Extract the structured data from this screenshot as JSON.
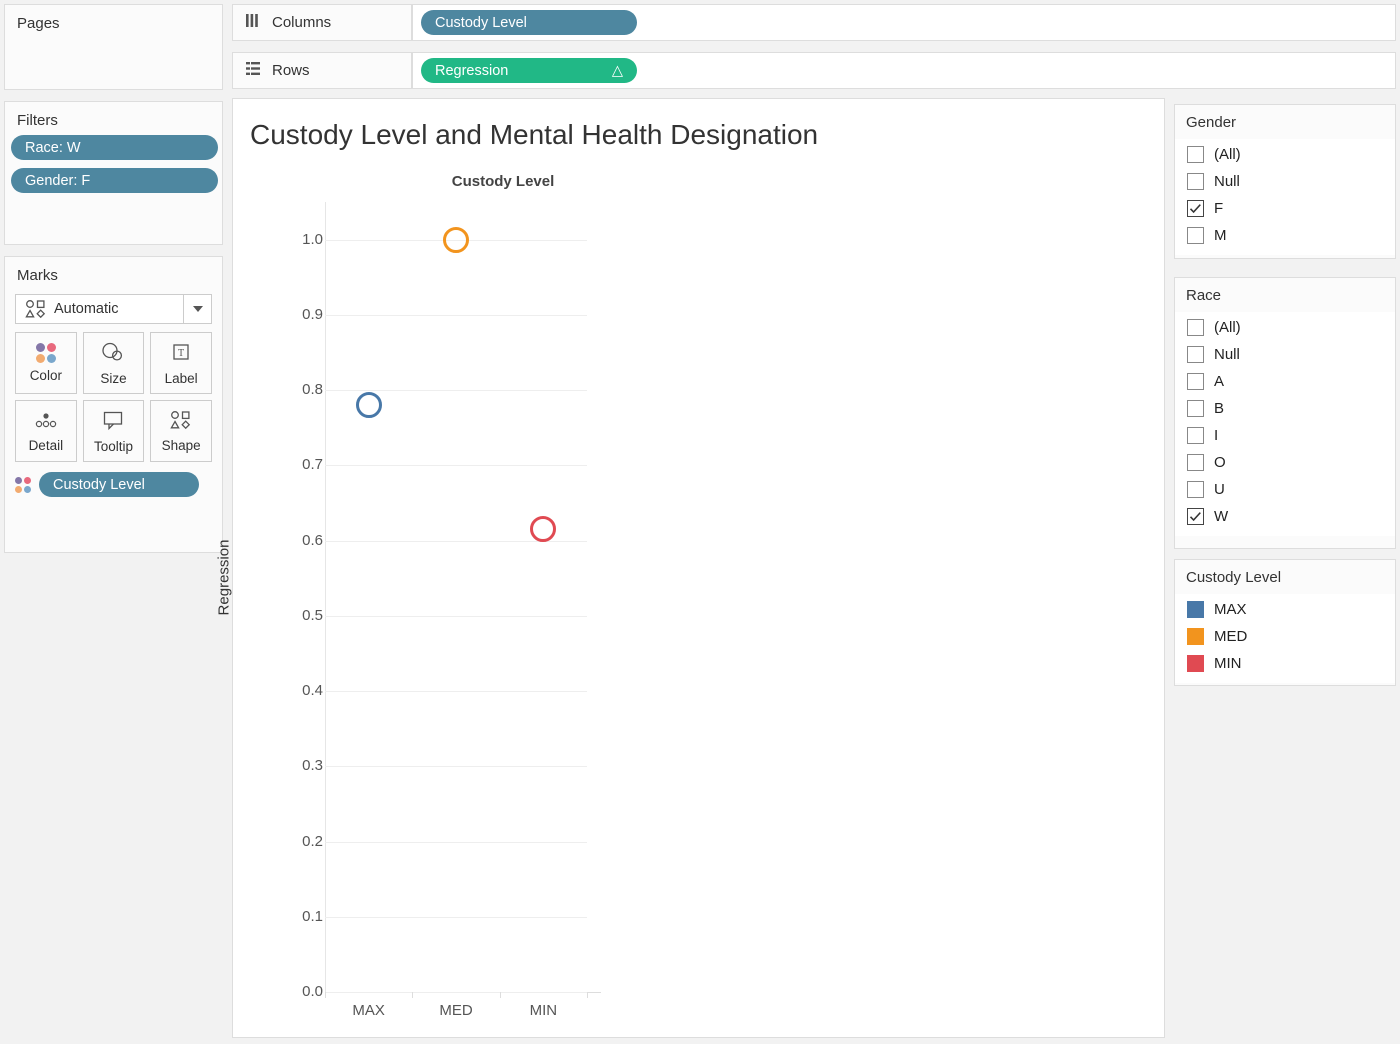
{
  "pages": {
    "title": "Pages"
  },
  "filters": {
    "title": "Filters",
    "pills": [
      {
        "label": "Race: W"
      },
      {
        "label": "Gender: F"
      }
    ]
  },
  "marks": {
    "title": "Marks",
    "type_label": "Automatic",
    "type_icon": "shapes-icon",
    "buttons": [
      {
        "label": "Color",
        "icon": "color-dots-icon"
      },
      {
        "label": "Size",
        "icon": "size-circles-icon"
      },
      {
        "label": "Label",
        "icon": "label-text-icon"
      },
      {
        "label": "Detail",
        "icon": "detail-dots-icon"
      },
      {
        "label": "Tooltip",
        "icon": "tooltip-bubble-icon"
      },
      {
        "label": "Shape",
        "icon": "shapes-icon"
      }
    ],
    "encoding_pill": {
      "label": "Custody Level",
      "icon": "color-dots-icon"
    }
  },
  "shelves": {
    "columns": {
      "label": "Columns",
      "icon": "columns-bars-icon",
      "pill": "Custody Level"
    },
    "rows": {
      "label": "Rows",
      "icon": "rows-list-icon",
      "pill": "Regression",
      "badge": "△"
    }
  },
  "viz": {
    "title": "Custody Level and Mental Health Designation",
    "column_header": "Custody Level"
  },
  "gender_filter": {
    "title": "Gender",
    "options": [
      {
        "label": "(All)",
        "checked": false
      },
      {
        "label": "Null",
        "checked": false
      },
      {
        "label": "F",
        "checked": true
      },
      {
        "label": "M",
        "checked": false
      }
    ]
  },
  "race_filter": {
    "title": "Race",
    "options": [
      {
        "label": "(All)",
        "checked": false
      },
      {
        "label": "Null",
        "checked": false
      },
      {
        "label": "A",
        "checked": false
      },
      {
        "label": "B",
        "checked": false
      },
      {
        "label": "I",
        "checked": false
      },
      {
        "label": "O",
        "checked": false
      },
      {
        "label": "U",
        "checked": false
      },
      {
        "label": "W",
        "checked": true
      }
    ]
  },
  "legend": {
    "title": "Custody Level",
    "items": [
      {
        "label": "MAX",
        "color": "#4878a8"
      },
      {
        "label": "MED",
        "color": "#f2941e"
      },
      {
        "label": "MIN",
        "color": "#e04a52"
      }
    ]
  },
  "chart_data": {
    "type": "scatter",
    "title": "Custody Level and Mental Health Designation",
    "column_header": "Custody Level",
    "xlabel": "",
    "ylabel": "Regression",
    "categories": [
      "MAX",
      "MED",
      "MIN"
    ],
    "yticks": [
      "0.0",
      "0.1",
      "0.2",
      "0.3",
      "0.4",
      "0.5",
      "0.6",
      "0.7",
      "0.8",
      "0.9",
      "1.0"
    ],
    "ylim": [
      0.0,
      1.05
    ],
    "grid": true,
    "legend_position": "right",
    "points": [
      {
        "x": "MAX",
        "y": 0.78,
        "color": "#4878a8",
        "series": "MAX"
      },
      {
        "x": "MED",
        "y": 1.0,
        "color": "#f2941e",
        "series": "MED"
      },
      {
        "x": "MIN",
        "y": 0.615,
        "color": "#e04a52",
        "series": "MIN"
      }
    ],
    "series": [
      {
        "name": "MAX",
        "values": [
          0.78
        ],
        "color": "#4878a8"
      },
      {
        "name": "MED",
        "values": [
          1.0
        ],
        "color": "#f2941e"
      },
      {
        "name": "MIN",
        "values": [
          0.615
        ],
        "color": "#e04a52"
      }
    ]
  }
}
